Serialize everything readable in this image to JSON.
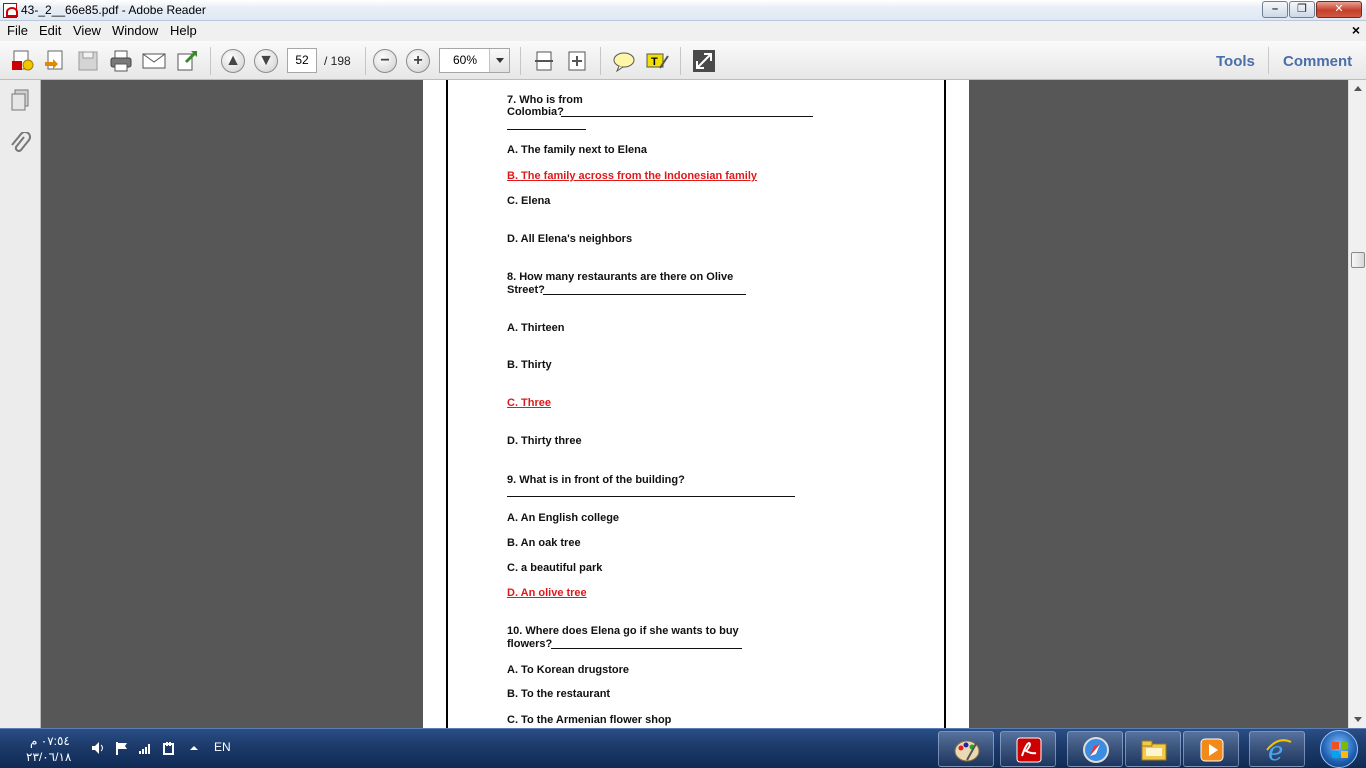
{
  "window": {
    "title": "43-_2__66e85.pdf - Adobe Reader",
    "minimize_label": "–",
    "maximize_label": "❐",
    "close_label": "✕"
  },
  "menu": {
    "items": [
      "File",
      "Edit",
      "View",
      "Window",
      "Help"
    ],
    "doc_close": "×"
  },
  "toolbar": {
    "page_current": "52",
    "page_total": "/ 198",
    "zoom": "60%",
    "tools_label": "Tools",
    "comment_label": "Comment",
    "icons": [
      "create-pdf-icon",
      "edit-pdf-icon",
      "save-icon",
      "print-icon",
      "email-icon",
      "export-icon",
      "prev-page-icon",
      "next-page-icon",
      "zoom-out-icon",
      "zoom-in-icon",
      "fit-page-icon",
      "fit-width-icon",
      "sticky-note-icon",
      "highlight-icon",
      "full-screen-icon"
    ]
  },
  "document": {
    "questions": [
      {
        "q1": "7. Who is from",
        "q2": "Colombia?",
        "answers": [
          "A. The family next to Elena",
          "B. The family across from the Indonesian family",
          "C. Elena",
          "D. All Elena's neighbors"
        ],
        "correct": 1
      },
      {
        "q1": "8. How many restaurants are there on Olive",
        "q2": "Street?",
        "answers": [
          "A. Thirteen",
          "B. Thirty",
          "C. Three",
          "D. Thirty three"
        ],
        "correct": 2
      },
      {
        "q1": "9. What is in front of the building?",
        "answers": [
          "A. An English college",
          "B. An oak tree",
          "C. a beautiful park",
          "D. An olive tree"
        ],
        "correct": 3
      },
      {
        "q1": "10. Where does Elena go if she wants to buy",
        "q2": "flowers?",
        "answers": [
          "A. To Korean drugstore",
          "B. To the restaurant",
          "C. To the Armenian flower shop"
        ],
        "correct": null
      }
    ]
  },
  "taskbar": {
    "time": "٠٧:٥٤ م",
    "date": "٢٣/٠٦/١٨",
    "language": "EN",
    "apps": [
      "paint-icon",
      "adobe-reader-icon",
      "safari-icon",
      "file-explorer-icon",
      "media-player-icon",
      "internet-explorer-icon"
    ]
  },
  "colors": {
    "answer_highlight": "#e0191a",
    "doc_background": "#575757",
    "taskbar": "#1c3a6a",
    "toolbar_link": "#4a6ea8"
  }
}
